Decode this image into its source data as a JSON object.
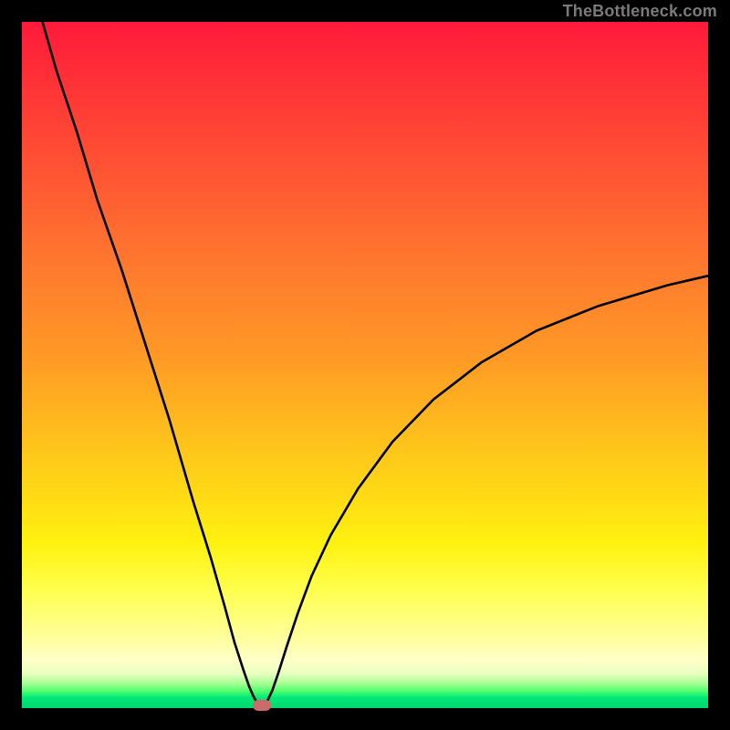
{
  "watermark": {
    "text": "TheBottleneck.com"
  },
  "chart_data": {
    "type": "line",
    "title": "",
    "xlabel": "",
    "ylabel": "",
    "xlim": [
      0,
      100
    ],
    "ylim": [
      0,
      100
    ],
    "grid": false,
    "series": [
      {
        "name": "bottleneck-curve",
        "x": [
          3,
          5,
          8,
          11,
          14.5,
          18,
          21.5,
          25,
          27.5,
          29.5,
          31,
          32.3,
          33.1,
          33.7,
          34.2,
          34.6,
          35,
          35.3,
          35.8,
          36.5,
          37.4,
          38.6,
          40.2,
          42.2,
          45,
          49,
          54,
          60,
          67,
          75,
          84,
          94,
          100
        ],
        "y": [
          100,
          93,
          84,
          74,
          64,
          53,
          42,
          30,
          22,
          15,
          9.5,
          5.5,
          3.2,
          1.8,
          0.9,
          0.4,
          0.2,
          0.4,
          1.1,
          2.6,
          5.2,
          9,
          13.8,
          19.2,
          25.2,
          32,
          38.8,
          45,
          50.4,
          55,
          58.6,
          61.6,
          63
        ]
      }
    ],
    "marker": {
      "x": 35,
      "y": 0.4,
      "color": "#cc6b6b"
    },
    "gradient_stops": [
      {
        "pos": 0.0,
        "color": "#ff1a3a"
      },
      {
        "pos": 0.5,
        "color": "#ff9726"
      },
      {
        "pos": 0.8,
        "color": "#ffff50"
      },
      {
        "pos": 0.96,
        "color": "#a0ff90"
      },
      {
        "pos": 1.0,
        "color": "#00d870"
      }
    ]
  }
}
